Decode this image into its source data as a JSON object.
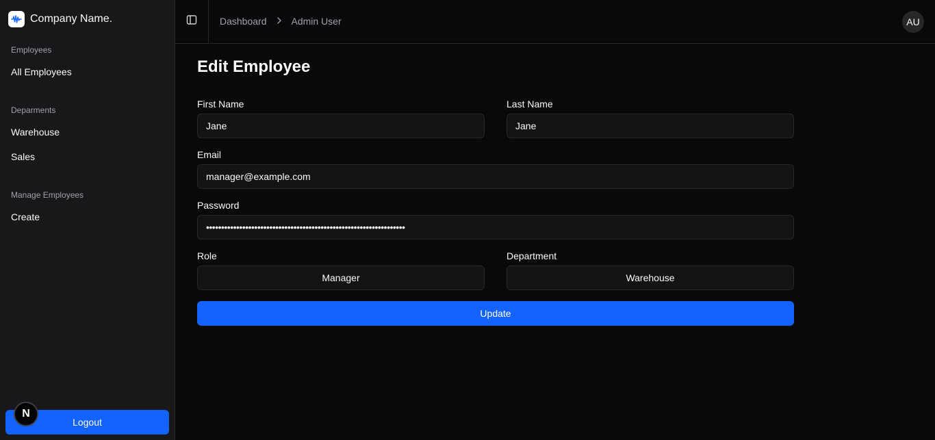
{
  "brand": {
    "name": "Company Name.",
    "logo_icon": "waveform-icon"
  },
  "sidebar": {
    "groups": [
      {
        "label": "Employees",
        "items": [
          {
            "label": "All Employees"
          }
        ]
      },
      {
        "label": "Deparments",
        "items": [
          {
            "label": "Warehouse"
          },
          {
            "label": "Sales"
          }
        ]
      },
      {
        "label": "Manage Employees",
        "items": [
          {
            "label": "Create"
          }
        ]
      }
    ],
    "logout_label": "Logout",
    "dev_badge": "N"
  },
  "header": {
    "toggle_icon": "sidebar-toggle-icon",
    "breadcrumb": [
      "Dashboard",
      "Admin User"
    ],
    "avatar_initials": "AU"
  },
  "form": {
    "title": "Edit Employee",
    "first_name": {
      "label": "First Name",
      "value": "Jane"
    },
    "last_name": {
      "label": "Last Name",
      "value": "Jane"
    },
    "email": {
      "label": "Email",
      "value": "manager@example.com"
    },
    "password": {
      "label": "Password",
      "value": "••••••••••••••••••••••••••••••••••••••••••••••••••••••••••••••••••"
    },
    "role": {
      "label": "Role",
      "selected": "Manager"
    },
    "department": {
      "label": "Department",
      "selected": "Warehouse"
    },
    "submit_label": "Update"
  },
  "colors": {
    "accent": "#1463ff",
    "background": "#09090b",
    "sidebar": "#18181b",
    "border": "#27272a"
  }
}
